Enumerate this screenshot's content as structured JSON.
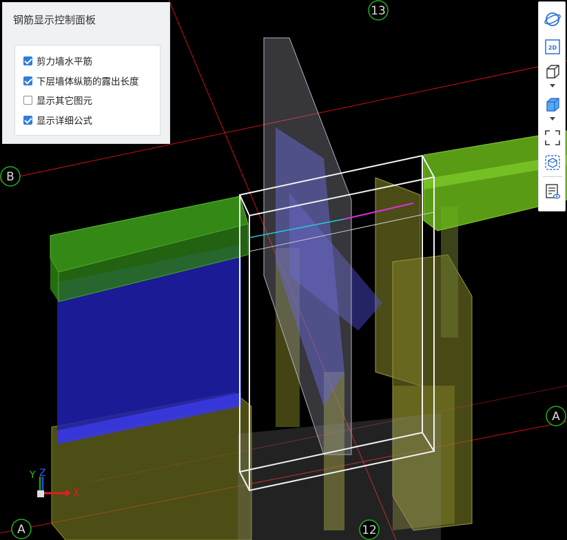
{
  "panel": {
    "title": "钢筋显示控制面板",
    "options": [
      {
        "label": "剪力墙水平筋",
        "checked": true
      },
      {
        "label": "下层墙体纵筋的露出长度",
        "checked": true
      },
      {
        "label": "显示其它图元",
        "checked": false
      },
      {
        "label": "显示详细公式",
        "checked": true
      }
    ]
  },
  "grid_axes": {
    "top": "13",
    "bottom": "12",
    "left_upper": "B",
    "left_lower": "A",
    "right": "A"
  },
  "toolbar": {
    "icons": [
      "orbit-icon",
      "2d-view-icon",
      "wireframe-cube-icon",
      "solid-cube-icon",
      "box-select-icon",
      "single-cube-icon",
      "properties-view-icon"
    ],
    "label_2d": "2D"
  },
  "triad": {
    "x": "X",
    "y": "Y",
    "z": "Z"
  },
  "colors": {
    "beam_green": "#3a9d18",
    "wall_blue": "#2626c8",
    "column_yellow": "#8a8a2a",
    "grid_red": "#e01010",
    "bubble_green": "#1db51d",
    "accent_blue": "#2e7de1"
  }
}
